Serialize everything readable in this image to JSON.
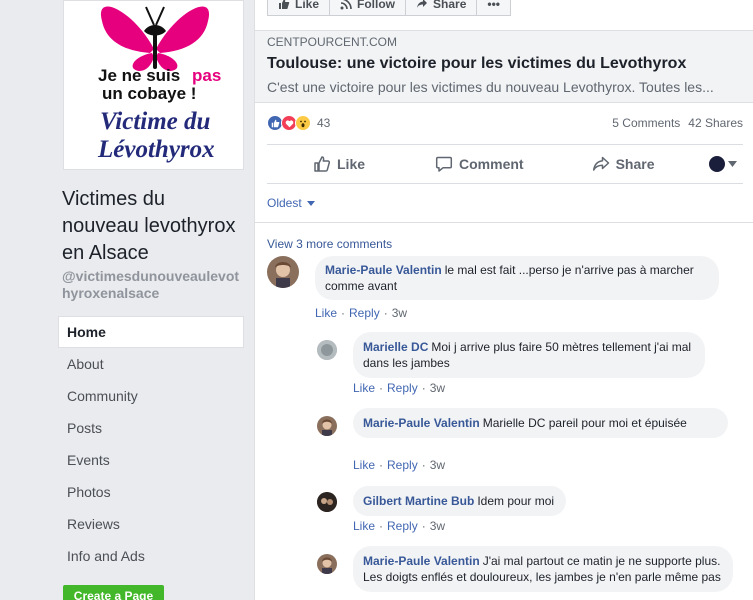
{
  "sidebar": {
    "profile_image": {
      "line1": "Je ne suis",
      "line1_accent": "pas",
      "line2": "un cobaye !",
      "line3": "Victime du",
      "line4": "Lévothyrox"
    },
    "page_name": "Victimes du nouveau levothyrox en Alsace",
    "handle": "@victimesdunouveaulevothyroxenalsace",
    "nav": [
      {
        "label": "Home",
        "active": true
      },
      {
        "label": "About"
      },
      {
        "label": "Community"
      },
      {
        "label": "Posts"
      },
      {
        "label": "Events"
      },
      {
        "label": "Photos"
      },
      {
        "label": "Reviews"
      },
      {
        "label": "Info and Ads"
      }
    ],
    "create_page_label": "Create a Page"
  },
  "post": {
    "top_actions": {
      "like": "Like",
      "follow": "Follow",
      "share": "Share",
      "more": "•••"
    },
    "link": {
      "domain": "CENTPOURCENT.COM",
      "title": "Toulouse: une victoire pour les victimes du Levothyrox",
      "description": "C'est une victoire pour les victimes du nouveau Levothyrox. Toutes les..."
    },
    "reactions": {
      "count": "43",
      "comments": "5 Comments",
      "shares": "42 Shares"
    },
    "actions": {
      "like": "Like",
      "comment": "Comment",
      "share": "Share"
    },
    "sort_label": "Oldest",
    "view_more": "View 3 more comments",
    "meta_labels": {
      "like": "Like",
      "reply": "Reply",
      "sep": "·"
    },
    "comments": [
      {
        "author": "Marie-Paule Valentin",
        "text": "le mal est fait ...perso je n'arrive pas à marcher comme avant",
        "time": "3w"
      },
      {
        "author": "Marielle DC",
        "text": "Moi j arrive plus faire 50 mètres tellement j'ai mal dans les jambes",
        "time": "3w"
      },
      {
        "author": "Marie-Paule Valentin",
        "text": "Marielle DC pareil pour moi et épuisée",
        "time": "3w"
      },
      {
        "author": "Gilbert Martine Bub",
        "text": "Idem pour moi",
        "time": "3w"
      },
      {
        "author": "Marie-Paule Valentin",
        "text": "J'ai mal partout ce matin je ne supporte plus. Les doigts enflés et douloureux, les jambes je n'en parle même pas",
        "time": ""
      }
    ]
  },
  "colors": {
    "brand_blue": "#4267b2",
    "link_blue": "#385898",
    "create_green": "#42b72a",
    "logo_pink": "#e6007e"
  }
}
